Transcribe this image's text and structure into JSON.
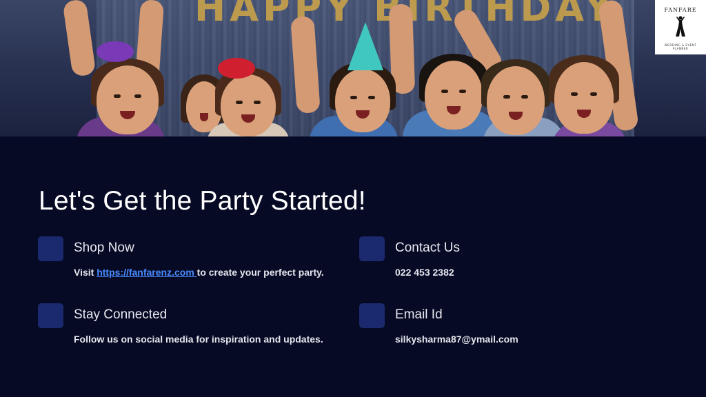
{
  "hero": {
    "banner_text": "HAPPY BIRTHDAY"
  },
  "logo": {
    "brand": "FANFARE",
    "tagline_line1": "WEDDING & EVENT",
    "tagline_line2": "PLANNER",
    "icon": "dancer-silhouette-icon"
  },
  "title": "Let's Get the Party Started!",
  "cards": {
    "shop": {
      "heading": "Shop Now",
      "desc_prefix": "Visit ",
      "link_text": "https://fanfarenz.com ",
      "desc_suffix": "to create your perfect party."
    },
    "contact": {
      "heading": "Contact Us",
      "desc": "022 453 2382"
    },
    "social": {
      "heading": "Stay Connected",
      "desc": "Follow us on social media for inspiration and updates."
    },
    "email": {
      "heading": "Email Id",
      "desc": "silkysharma87@ymail.com"
    }
  },
  "colors": {
    "background": "#070a24",
    "icon_square": "#1b2a6e",
    "link": "#4a8cff",
    "title": "#ffffff"
  }
}
